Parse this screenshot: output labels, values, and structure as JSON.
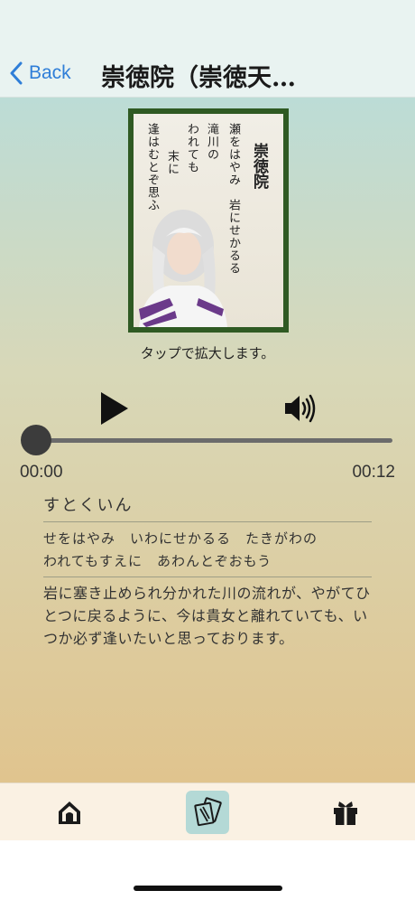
{
  "nav": {
    "back_label": "Back",
    "title": "崇徳院（崇徳天皇）"
  },
  "card": {
    "poet": "崇徳院",
    "poem_lines": [
      "瀬をはやみ　岩にせかるる",
      "滝川の",
      "われても",
      "末に",
      "逢はむとぞ思ふ"
    ],
    "frame_color": "#2f5a23"
  },
  "caption": "タップで拡大します。",
  "player": {
    "current_time": "00:00",
    "total_time": "00:12",
    "progress": 0,
    "play_icon": "play-icon",
    "volume_icon": "volume-icon"
  },
  "reading": "すとくいん",
  "kana": {
    "line1": "せをはやみ　いわにせかるる　たきがわの",
    "line2": "われてもすえに　あわんとぞおもう"
  },
  "meaning": "岩に塞き止められ分かれた川の流れが、やがてひとつに戻るように、今は貴女と離れていても、いつか必ず逢いたいと思っております。",
  "tabs": [
    {
      "name": "home",
      "icon": "home-icon",
      "active": false
    },
    {
      "name": "cards",
      "icon": "cards-icon",
      "active": true
    },
    {
      "name": "gift",
      "icon": "gift-icon",
      "active": false
    }
  ],
  "colors": {
    "accent": "#2f7ed8",
    "active_tab": "#b4d9d6"
  }
}
